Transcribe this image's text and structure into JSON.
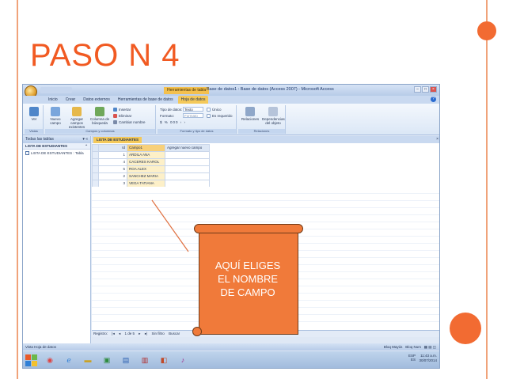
{
  "slide": {
    "title": "PASO N 4",
    "callout": [
      "AQUÍ ELIGES",
      "EL NOMBRE",
      "DE CAMPO"
    ],
    "colors": {
      "accent": "#f15a22",
      "callout": "#f07a3a"
    }
  },
  "window": {
    "context_tab": "Herramientas de tabla",
    "title": "Base de datos1 : Base de datos (Access 2007) - Microsoft Access"
  },
  "tabs": [
    "Inicio",
    "Crear",
    "Datos externos",
    "Herramientas de base de datos",
    "Hoja de datos"
  ],
  "ribbon": {
    "views": {
      "ver": "Ver",
      "label": "Vistas"
    },
    "campos": {
      "nuevo": "Nuevo campo",
      "agregar": "Agregar campos existentes",
      "busqueda": "Columna de búsqueda",
      "insertar": "Insertar",
      "eliminar": "Eliminar",
      "cambiar": "Cambiar nombre",
      "label": "Campos y columnas"
    },
    "formato": {
      "tipo_label": "Tipo de datos:",
      "tipo_value": "Texto",
      "formato_label": "Formato:",
      "formato_value": "Formato",
      "unico": "Único",
      "requerido": "Es requerido",
      "label": "Formato y tipo de datos"
    },
    "relaciones": {
      "relaciones": "Relaciones",
      "dependencias": "Dependencias del objeto",
      "label": "Relaciones"
    }
  },
  "nav": {
    "header": "Todas las tablas",
    "group": "LISTA DE ESTUDIANTES",
    "item": "LISTA DE ESTUDIANTES : Tabla"
  },
  "datasheet": {
    "tab": "LISTA DE ESTUDIANTES",
    "headers": [
      "Id",
      "Campo1",
      "Agregar nuevo campo"
    ],
    "rows": [
      {
        "id": "1",
        "name": "ARDILA ANA"
      },
      {
        "id": "4",
        "name": "CACERES KAROL"
      },
      {
        "id": "5",
        "name": "ROA ALEX"
      },
      {
        "id": "2",
        "name": "SANCHEZ MARIA"
      },
      {
        "id": "3",
        "name": "VEGA TATIANA"
      }
    ],
    "new_row": "(Nuevo)",
    "new_marker": "*"
  },
  "recnav": {
    "label": "Registro:",
    "position": "1 de 5",
    "filter": "Sin filtro",
    "search": "Buscar"
  },
  "statusbar": {
    "left": "Vista Hoja de datos",
    "caps": "Bloq Mayús",
    "num": "Bloq Num"
  },
  "tray": {
    "lang1": "ESP",
    "lang2": "ES",
    "time": "11:43 a.m.",
    "date": "30/07/2014"
  }
}
